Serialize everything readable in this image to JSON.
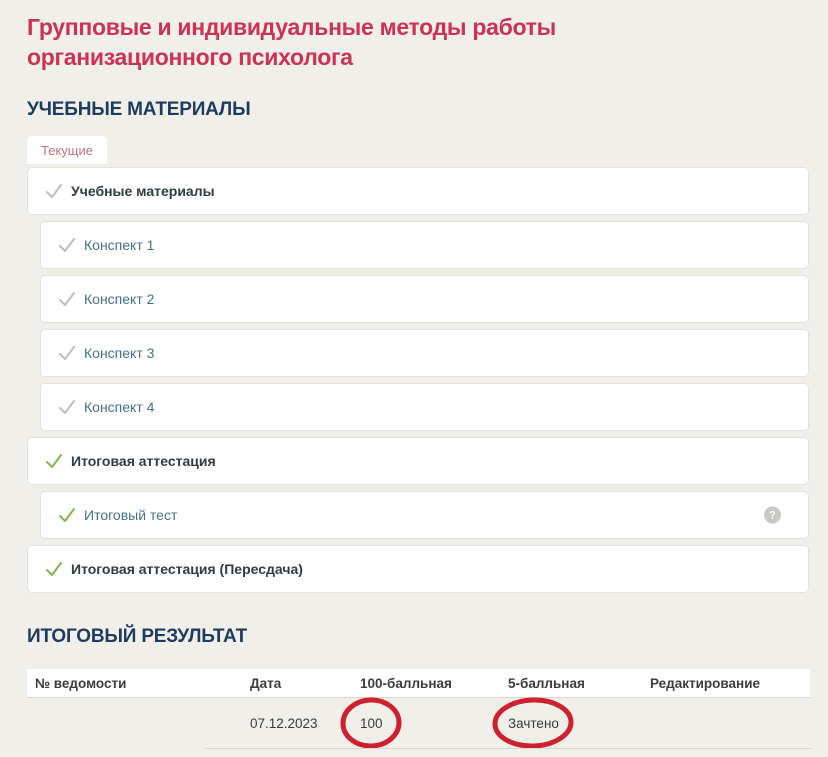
{
  "page": {
    "title": "Групповые и индивидуальные методы работы организационного психолога"
  },
  "colors": {
    "background": "#f0efea",
    "title_red": "#cd3256",
    "heading_navy": "#1f3c60",
    "link_teal": "#45718c",
    "text_dark": "#333b40",
    "check_gray": "#bdbdbd",
    "check_green": "#85b54d",
    "tab_text": "#c4737f",
    "annotation_red": "#cf2030"
  },
  "materials_section": {
    "heading": "УЧЕБНЫЕ МАТЕРИАЛЫ",
    "tab": "Текущие",
    "items": [
      {
        "label": "Учебные материалы",
        "level": 0,
        "check": "gray",
        "style": "bold",
        "help_icon": false
      },
      {
        "label": "Конспект 1",
        "level": 1,
        "check": "gray",
        "style": "link",
        "help_icon": false
      },
      {
        "label": "Конспект 2",
        "level": 1,
        "check": "gray",
        "style": "link",
        "help_icon": false
      },
      {
        "label": "Конспект 3",
        "level": 1,
        "check": "gray",
        "style": "link",
        "help_icon": false
      },
      {
        "label": "Конспект 4",
        "level": 1,
        "check": "gray",
        "style": "link",
        "help_icon": false
      },
      {
        "label": "Итоговая аттестация",
        "level": 0,
        "check": "green",
        "style": "bold",
        "help_icon": false
      },
      {
        "label": "Итоговый тест",
        "level": 1,
        "check": "green",
        "style": "link",
        "help_icon": true
      },
      {
        "label": "Итоговая аттестация (Пересдача)",
        "level": 0,
        "check": "green",
        "style": "bold",
        "help_icon": false
      }
    ],
    "help_icon_glyph": "?"
  },
  "results_section": {
    "heading": "ИТОГОВЫЙ РЕЗУЛЬТАТ",
    "table": {
      "headers": [
        "№ ведомости",
        "Дата",
        "100-балльная",
        "5-балльная",
        "Редактирование"
      ],
      "rows": [
        {
          "vedomost": "",
          "date": "07.12.2023",
          "score100": "100",
          "score5": "Зачтено",
          "edit": "",
          "circled": [
            "score100",
            "score5"
          ]
        }
      ]
    }
  }
}
